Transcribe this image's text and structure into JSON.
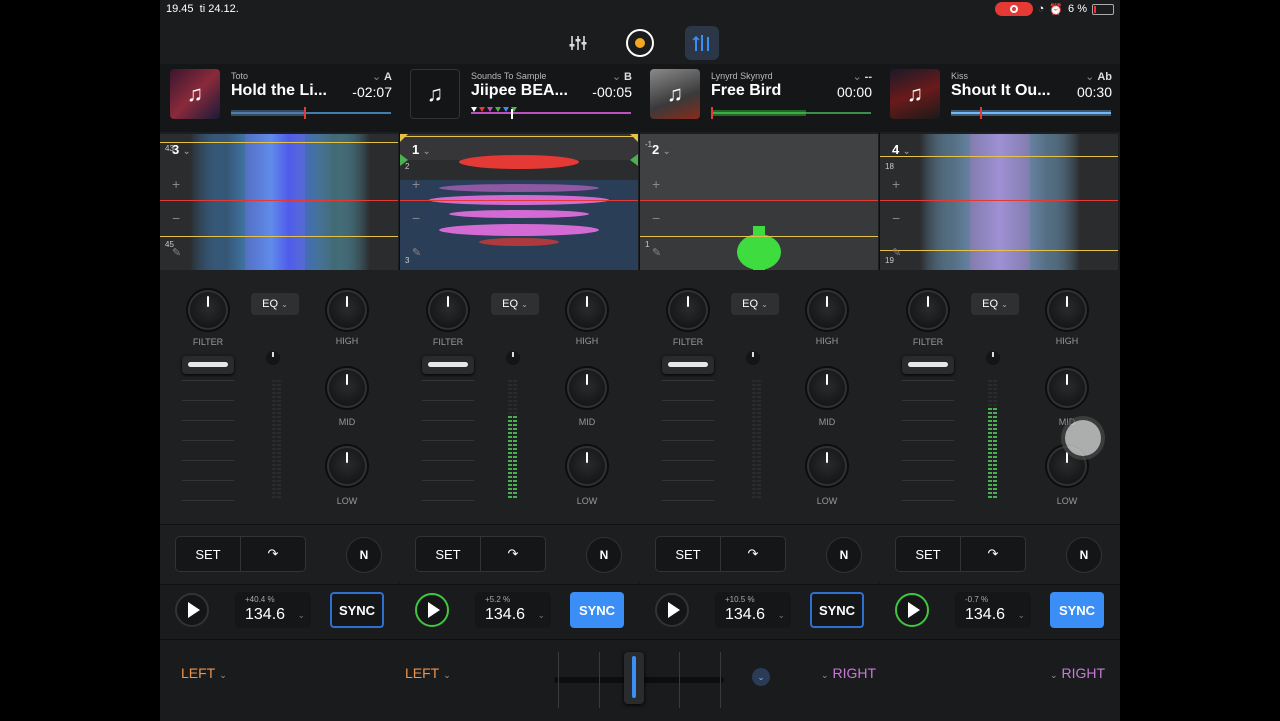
{
  "status": {
    "time": "19.45",
    "date": "ti 24.12.",
    "battery": "6 %"
  },
  "decks": [
    {
      "artist": "Toto",
      "title": "Hold the Li...",
      "letter": "A",
      "time": "-02:07",
      "wave_color": "#5ab0ff",
      "badge": "3",
      "cue_top": "43",
      "cue_bottom": "45",
      "eq_label": "EQ",
      "filter_label": "FILTER",
      "high_label": "HIGH",
      "mid_label": "MID",
      "low_label": "LOW",
      "set_label": "SET",
      "n_label": "N",
      "pitch": "+40.4 %",
      "bpm": "134.6",
      "sync_label": "SYNC",
      "sync_active": false,
      "playing": false
    },
    {
      "artist": "Sounds To Sample",
      "title": "Jiipee BEA...",
      "letter": "B",
      "time": "-00:05",
      "wave_color": "#d46bd4",
      "badge": "1",
      "cue_top": "2",
      "cue_bottom": "3",
      "eq_label": "EQ",
      "filter_label": "FILTER",
      "high_label": "HIGH",
      "mid_label": "MID",
      "low_label": "LOW",
      "set_label": "SET",
      "n_label": "N",
      "pitch": "+5.2 %",
      "bpm": "134.6",
      "sync_label": "SYNC",
      "sync_active": true,
      "playing": true
    },
    {
      "artist": "Lynyrd Skynyrd",
      "title": "Free Bird",
      "letter": "--",
      "time": "00:00",
      "wave_color": "#3fdc3f",
      "badge": "2",
      "cue_top": "-1",
      "cue_bottom": "1",
      "eq_label": "EQ",
      "filter_label": "FILTER",
      "high_label": "HIGH",
      "mid_label": "MID",
      "low_label": "LOW",
      "set_label": "SET",
      "n_label": "N",
      "pitch": "+10.5 %",
      "bpm": "134.6",
      "sync_label": "SYNC",
      "sync_active": false,
      "playing": false
    },
    {
      "artist": "Kiss",
      "title": "Shout It Ou...",
      "letter": "Ab",
      "time": "00:30",
      "wave_color": "#8fd0ff",
      "badge": "4",
      "cue_top": "18",
      "cue_bottom": "19",
      "eq_label": "EQ",
      "filter_label": "FILTER",
      "high_label": "HIGH",
      "mid_label": "MID",
      "low_label": "LOW",
      "set_label": "SET",
      "n_label": "N",
      "pitch": "-0.7 %",
      "bpm": "134.6",
      "sync_label": "SYNC",
      "sync_active": true,
      "playing": true
    }
  ],
  "bottom": {
    "fx1": "LEFT",
    "fx2": "LEFT",
    "fx3": "RIGHT",
    "fx4": "RIGHT",
    "fx1_color": "#f0934a",
    "fx2_color": "#f0934a",
    "fx3_color": "#c77ad6",
    "fx4_color": "#c77ad6"
  },
  "colors": {
    "accent": "#3a8ef5",
    "play_on": "#43c443",
    "record": "#e53935",
    "meter": "#4caf50"
  },
  "icons": {
    "mixer": "mixer-icon",
    "record": "record-icon",
    "deck_view": "deck-view-icon"
  }
}
